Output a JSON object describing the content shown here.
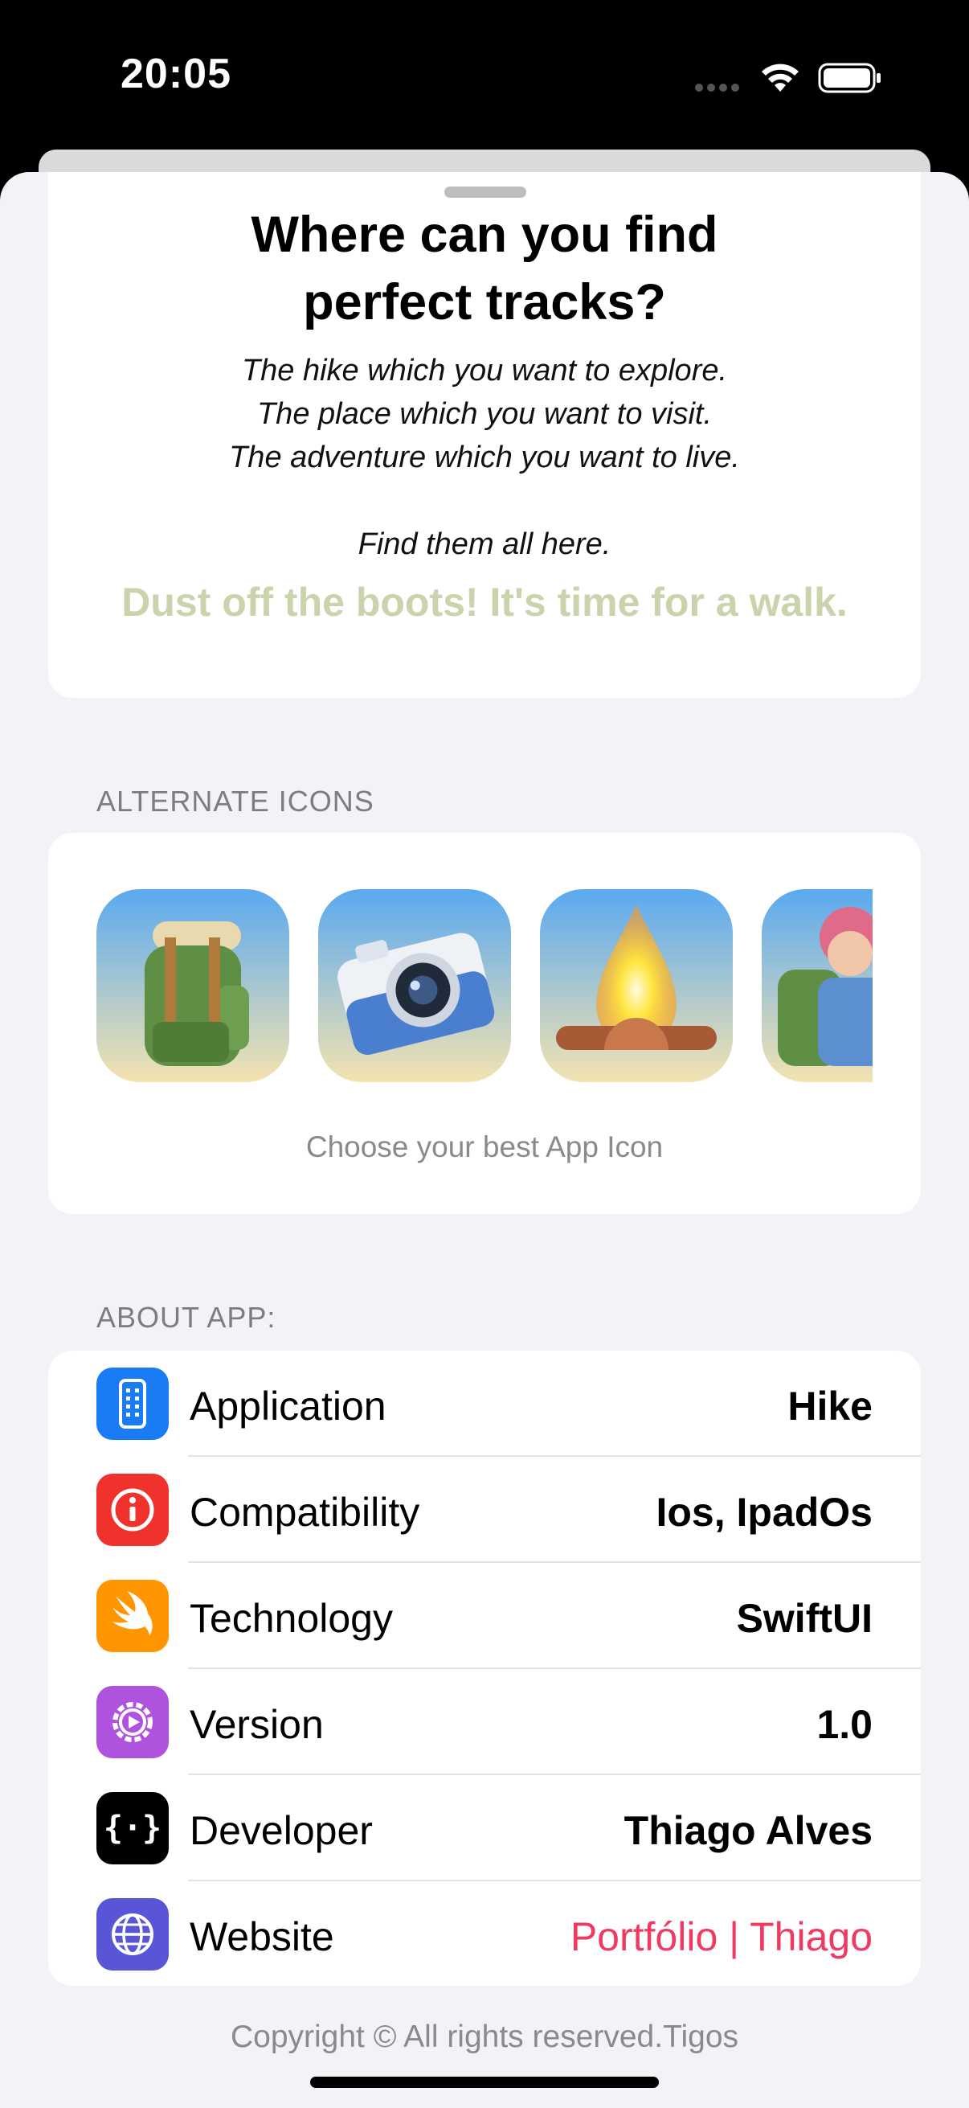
{
  "status_bar": {
    "time": "20:05"
  },
  "hero": {
    "title": "Where can you find perfect tracks?",
    "description": "The hike which you want to explore.\nThe place which you want to visit.\nThe adventure which you want to live.\n\nFind them all here.",
    "tagline": "Dust off the boots! It's time for a walk."
  },
  "alternate_icons": {
    "header": "ALTERNATE ICONS",
    "icons": [
      "backpack-icon",
      "camera-icon",
      "campfire-icon",
      "hiker-icon"
    ],
    "caption": "Choose your best App Icon"
  },
  "about": {
    "header": "ABOUT APP:",
    "rows": [
      {
        "icon": "apps-iphone-icon",
        "color": "#1a7cf5",
        "label": "Application",
        "value": "Hike"
      },
      {
        "icon": "info-circle-icon",
        "color": "#f0322c",
        "label": "Compatibility",
        "value": "Ios, IpadOs"
      },
      {
        "icon": "swift-icon",
        "color": "#ff9500",
        "label": "Technology",
        "value": "SwiftUI"
      },
      {
        "icon": "gear-icon",
        "color": "#af52de",
        "label": "Version",
        "value": "1.0"
      },
      {
        "icon": "ellipsis-curlybraces-icon",
        "color": "#000000",
        "label": "Developer",
        "value": "Thiago Alves"
      },
      {
        "icon": "globe-icon",
        "color": "#5856d6",
        "label": "Website",
        "value": "Portfólio | Thiago",
        "value_color": "#f03a62"
      }
    ]
  },
  "footer": {
    "copyright": "Copyright © All rights reserved.Tigos"
  }
}
